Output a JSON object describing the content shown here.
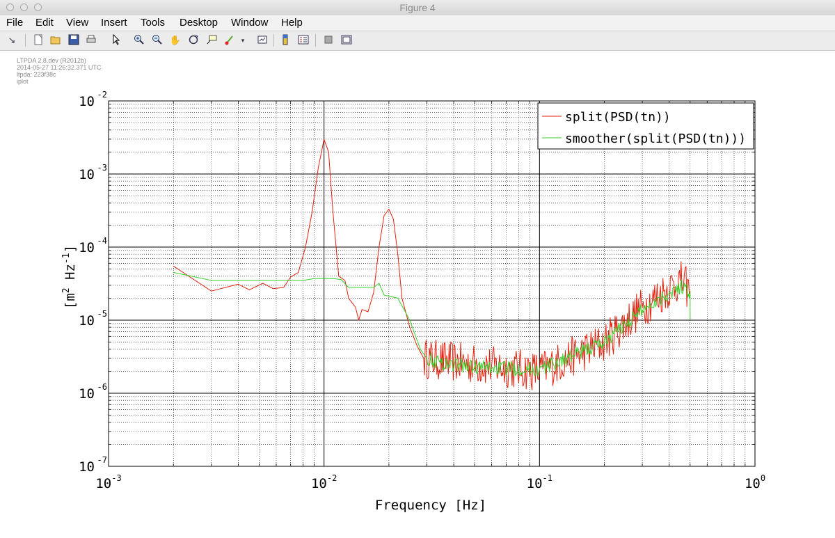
{
  "window": {
    "title": "Figure 4"
  },
  "menu": {
    "items": [
      "File",
      "Edit",
      "View",
      "Insert",
      "Tools",
      "Desktop",
      "Window",
      "Help"
    ]
  },
  "toolbar": {
    "icons": [
      "arrow-icon",
      "new-figure-icon",
      "open-file-icon",
      "save-icon",
      "print-icon",
      "select-pointer-icon",
      "zoom-in-icon",
      "zoom-out-icon",
      "pan-hand-icon",
      "rotate-3d-icon",
      "data-cursor-icon",
      "brush-icon",
      "brush-dropdown-icon",
      "link-plot-icon",
      "colorbar-icon",
      "legend-icon",
      "hide-plot-tools-icon",
      "show-plot-tools-icon"
    ]
  },
  "metadata": {
    "line1": "LTPDA 2.8.dev (R2012b)",
    "line2": "2014-05-27 11:26:32.371 UTC",
    "line3": "ltpda: 223f38c",
    "line4": "iplot"
  },
  "chart_data": {
    "type": "line",
    "xscale": "log",
    "yscale": "log",
    "xlim": [
      0.001,
      1
    ],
    "ylim": [
      1e-07,
      0.01
    ],
    "grid": true,
    "legend_position": "top-right",
    "xlabel": "Frequency   [Hz]",
    "ylabel": {
      "open": "[m",
      "exp1": "2",
      "mid": " Hz",
      "exp2": "-1",
      "close": "]"
    },
    "xticks": [
      {
        "value": 0.001,
        "base": "10",
        "exp": "-3"
      },
      {
        "value": 0.01,
        "base": "10",
        "exp": "-2"
      },
      {
        "value": 0.1,
        "base": "10",
        "exp": "-1"
      },
      {
        "value": 1,
        "base": "10",
        "exp": "0"
      }
    ],
    "yticks": [
      {
        "value": 0.01,
        "base": "10",
        "exp": "-2"
      },
      {
        "value": 0.001,
        "base": "10",
        "exp": "-3"
      },
      {
        "value": 0.0001,
        "base": "10",
        "exp": "-4"
      },
      {
        "value": 1e-05,
        "base": "10",
        "exp": "-5"
      },
      {
        "value": 1e-06,
        "base": "10",
        "exp": "-6"
      },
      {
        "value": 1e-07,
        "base": "10",
        "exp": "-7"
      }
    ],
    "series": [
      {
        "name": "split(PSD(tn))",
        "color": "#e3200d",
        "noise_from": 0.029,
        "points": [
          [
            0.002,
            5.5e-05
          ],
          [
            0.003,
            2.5e-05
          ],
          [
            0.004,
            3.1e-05
          ],
          [
            0.0045,
            2.6e-05
          ],
          [
            0.0052,
            3.2e-05
          ],
          [
            0.0058,
            2.7e-05
          ],
          [
            0.0065,
            2.8e-05
          ],
          [
            0.007,
            3.9e-05
          ],
          [
            0.0076,
            4.5e-05
          ],
          [
            0.0082,
            0.0001
          ],
          [
            0.0088,
            0.0003
          ],
          [
            0.0094,
            0.0012
          ],
          [
            0.01,
            0.003
          ],
          [
            0.0105,
            0.002
          ],
          [
            0.011,
            0.0003
          ],
          [
            0.0117,
            4e-05
          ],
          [
            0.0125,
            3.5e-05
          ],
          [
            0.013,
            2e-05
          ],
          [
            0.014,
            1.5e-05
          ],
          [
            0.0145,
            1e-05
          ],
          [
            0.015,
            1.4e-05
          ],
          [
            0.016,
            1.3e-05
          ],
          [
            0.017,
            2.4e-05
          ],
          [
            0.018,
            0.0001
          ],
          [
            0.019,
            0.00027
          ],
          [
            0.02,
            0.00033
          ],
          [
            0.021,
            0.00024
          ],
          [
            0.022,
            8e-05
          ],
          [
            0.023,
            2e-05
          ],
          [
            0.025,
            8e-06
          ],
          [
            0.027,
            4.5e-06
          ],
          [
            0.029,
            3e-06
          ],
          [
            0.05,
            2.5e-06
          ],
          [
            0.1,
            2e-06
          ],
          [
            0.2,
            5e-06
          ],
          [
            0.3,
            1.5e-05
          ],
          [
            0.45,
            3.5e-05
          ],
          [
            0.5,
            2.5e-05
          ]
        ]
      },
      {
        "name": "smoother(split(PSD(tn)))",
        "color": "#36d12a",
        "noise_from": 0.03,
        "points": [
          [
            0.002,
            4.5e-05
          ],
          [
            0.003,
            3.5e-05
          ],
          [
            0.005,
            3.5e-05
          ],
          [
            0.008,
            3.5e-05
          ],
          [
            0.009,
            3.7e-05
          ],
          [
            0.011,
            3.7e-05
          ],
          [
            0.012,
            3.6e-05
          ],
          [
            0.013,
            2.8e-05
          ],
          [
            0.017,
            2.8e-05
          ],
          [
            0.018,
            3.2e-05
          ],
          [
            0.019,
            2.2e-05
          ],
          [
            0.022,
            2e-05
          ],
          [
            0.025,
            1e-05
          ],
          [
            0.028,
            4e-06
          ],
          [
            0.03,
            3e-06
          ],
          [
            0.035,
            2.6e-06
          ],
          [
            0.05,
            2.3e-06
          ],
          [
            0.1,
            2.1e-06
          ],
          [
            0.2,
            5e-06
          ],
          [
            0.3,
            1.4e-05
          ],
          [
            0.45,
            2.9e-05
          ],
          [
            0.5,
            2.5e-05
          ],
          [
            0.5,
            1e-05
          ]
        ]
      }
    ]
  }
}
